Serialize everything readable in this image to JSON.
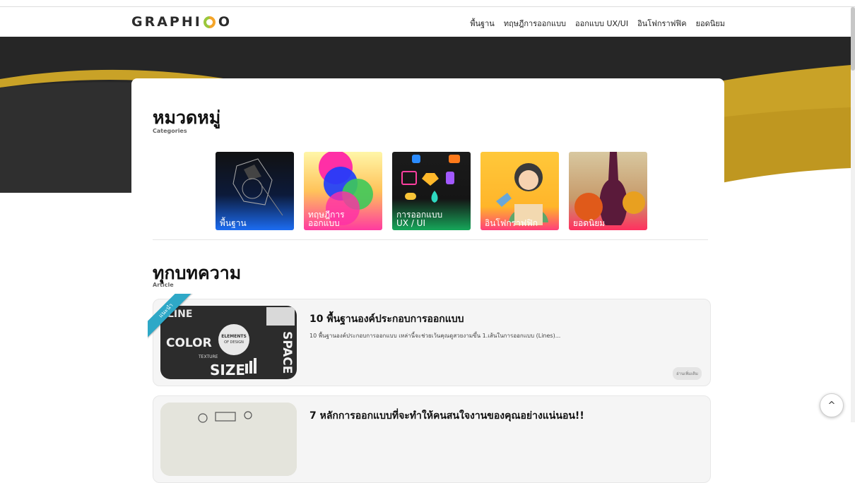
{
  "header": {
    "logo_left": "GRAPHI",
    "logo_right": "O",
    "nav": [
      "พื้นฐาน",
      "ทฤษฎีการออกแบบ",
      "ออกแบบ UX/UI",
      "อินโฟกราฟฟิค",
      "ยอดนิยม"
    ]
  },
  "categories": {
    "title": "หมวดหมู่",
    "subtitle": "Categories",
    "items": [
      {
        "label": "พื้นฐาน"
      },
      {
        "label": "ทฤษฎีการ\nออกแบบ"
      },
      {
        "label": "การออกแบบ\nUX / UI"
      },
      {
        "label": "อินโฟกราฟฟิก"
      },
      {
        "label": "ยอดนิยม"
      }
    ]
  },
  "articles": {
    "title": "ทุกบทความ",
    "subtitle": "Article",
    "ribbon": "แนะนำ",
    "items": [
      {
        "title": "10 พื้นฐานองค์ประกอบการออกแบบ",
        "excerpt": "10 พื้นฐานองค์ประกอบการออกแบบ เหล่านี้จะช่วยเว้นคุณดูสวยงามขึ้น 1.เส้นในการออกแบบ (Lines)...",
        "read_more": "อ่านเพิ่มเติม",
        "thumb_words": [
          "LINE",
          "COLOR",
          "ELEMENTS",
          "OF DESIGN",
          "TEXTURE",
          "SIZE",
          "SPACE"
        ]
      },
      {
        "title": "7 หลักการออกแบบที่จะทำให้คนสนใจงานของคุณอย่างแน่นอน!!"
      }
    ]
  },
  "back_to_top": "^",
  "colors": {
    "gold": "#c9a227",
    "dark": "#272727",
    "ribbon": "#2ea8c7"
  }
}
